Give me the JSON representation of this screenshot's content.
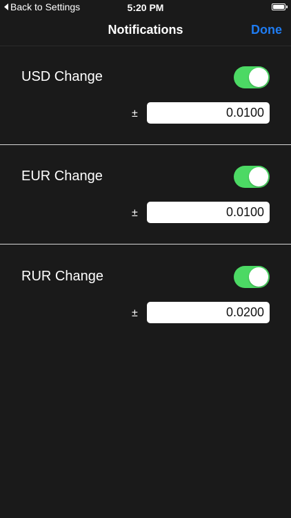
{
  "status_bar": {
    "back_label": "Back to Settings",
    "time": "5:20 PM"
  },
  "nav": {
    "title": "Notifications",
    "done_label": "Done"
  },
  "colors": {
    "accent": "#1f7cf2",
    "toggle_on": "#4cd964",
    "background": "#1a1a1a"
  },
  "sections": [
    {
      "label": "USD Change",
      "enabled": true,
      "prefix": "±",
      "value": "0.0100"
    },
    {
      "label": "EUR Change",
      "enabled": true,
      "prefix": "±",
      "value": "0.0100"
    },
    {
      "label": "RUR Change",
      "enabled": true,
      "prefix": "±",
      "value": "0.0200"
    }
  ]
}
